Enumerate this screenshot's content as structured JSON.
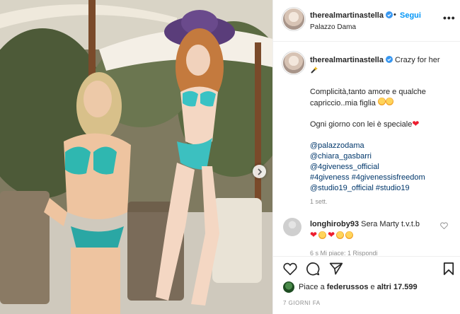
{
  "post": {
    "username": "therealmartinastella",
    "follow_label": "Segui",
    "separator": "•",
    "location": "Palazzo Dama",
    "more_label": "•••"
  },
  "caption": {
    "username": "therealmartinastella",
    "title": "Crazy for her",
    "line1": "Complicità,tanto amore e qualche capriccio..mia figlia",
    "line2": "Ogni giorno con lei è speciale",
    "tags": [
      "@palazzodama",
      "@chiara_gasbarri",
      "@4giveness_official",
      "#4giveness #4givenessisfreedom",
      "@studio19_official #studio19"
    ],
    "time": "1 sett."
  },
  "comment": {
    "username": "longhiroby93",
    "text": "Sera Marty t.v.t.b",
    "meta": "6 s   Mi piace: 1   Rispondi"
  },
  "actions": {
    "likes_prefix": "Piace a",
    "liker": "federussos",
    "likes_middle": "e",
    "likes_rest": "altri 17.599",
    "post_time": "7 GIORNI FA"
  },
  "icons": {
    "like": "heart-icon",
    "comment": "comment-bubble-icon",
    "share": "paper-plane-icon",
    "save": "bookmark-icon",
    "verified": "verified-badge-icon",
    "next": "chevron-right-icon"
  },
  "colors": {
    "link": "#00376b",
    "follow": "#0095f6",
    "verified": "#3897f0",
    "muted": "#8e8e8e",
    "heart": "#ed1c2e"
  }
}
